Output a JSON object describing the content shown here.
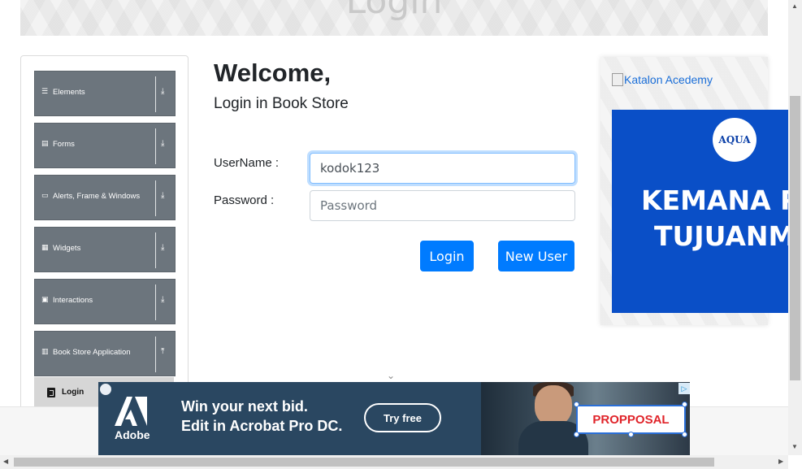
{
  "header": {
    "title": "Login"
  },
  "sidebar": {
    "groups": [
      {
        "label": "Elements",
        "icon": "hamburger-icon",
        "arrow": "download-arrow-icon"
      },
      {
        "label": "Forms",
        "icon": "form-icon",
        "arrow": "download-arrow-icon"
      },
      {
        "label": "Alerts, Frame & Windows",
        "icon": "window-icon",
        "arrow": "download-arrow-icon"
      },
      {
        "label": "Widgets",
        "icon": "grid-icon",
        "arrow": "download-arrow-icon"
      },
      {
        "label": "Interactions",
        "icon": "interaction-icon",
        "arrow": "download-arrow-icon"
      },
      {
        "label": "Book Store Application",
        "icon": "books-icon",
        "arrow": "upload-arrow-icon"
      }
    ],
    "active_item": {
      "label": "Login",
      "icon": "html5-icon"
    }
  },
  "main": {
    "heading": "Welcome,",
    "subheading": "Login in Book Store",
    "username_label": "UserName :",
    "username_value": "kodok123",
    "password_label": "Password :",
    "password_placeholder": "Password",
    "login_button": "Login",
    "new_user_button": "New User"
  },
  "right_ad": {
    "link_text": "Katalon Acedemy",
    "aqua_logo": "AQUA",
    "aqua_line1": "KEMANA P",
    "aqua_line2": "TUJUANM"
  },
  "bottom_ad": {
    "brand": "Adobe",
    "headline1": "Win your next bid.",
    "headline2": "Edit in Acrobat Pro DC.",
    "cta": "Try free",
    "proposal_text": "PROPPOSAL"
  },
  "colors": {
    "primary": "#007bff",
    "sidebar_group": "#6c757d",
    "aqua_blue": "#0a4fc7",
    "adobe_bg": "#2a4761",
    "proposal_red": "#e0242a"
  }
}
